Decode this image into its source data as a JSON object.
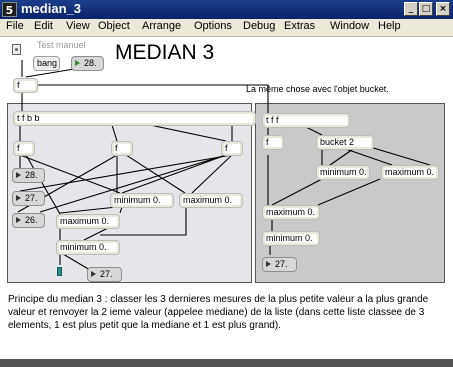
{
  "window": {
    "title": "median_3"
  },
  "menubar": {
    "items": [
      "File",
      "Edit",
      "View",
      "Object",
      "Arrange",
      "Options",
      "Debug",
      "Extras",
      "Window",
      "Help"
    ]
  },
  "patch": {
    "title": "MEDIAN 3",
    "test_label": "Test manuel",
    "bang_label": "bang",
    "number_top": "28.",
    "f_top": "f",
    "bucket_comment": "La même chose avec l'objet bucket.",
    "left": {
      "tfbb": "t f b b",
      "f1": "f",
      "f2": "f",
      "f3": "f",
      "n28": "28.",
      "n27": "27.",
      "n26": "26.",
      "min1": "minimum 0.",
      "max1": "maximum 0.",
      "max2": "maximum 0.",
      "min2": "minimum 0.",
      "out": "27."
    },
    "right": {
      "tff": "t f f",
      "f1": "f",
      "bucket": "bucket 2",
      "min1": "minimum 0.",
      "max1": "maximum 0.",
      "max2": "maximum 0.",
      "min2": "minimum 0.",
      "out": "27."
    },
    "explanation": "Principe du median 3 : classer les 3 dernieres mesures de la plus petite valeur a la plus grande valeur et renvoyer la 2 ieme valeur (appelee mediane) de la liste (dans cette liste classee de 3 elements, 1 est plus petit que la mediane et 1 est plus grand)."
  },
  "colors": {
    "titlebar": "#0a246a",
    "subpatch_left": "#e6e6ea",
    "subpatch_right": "#c9c9c9",
    "wire": "#000000"
  }
}
